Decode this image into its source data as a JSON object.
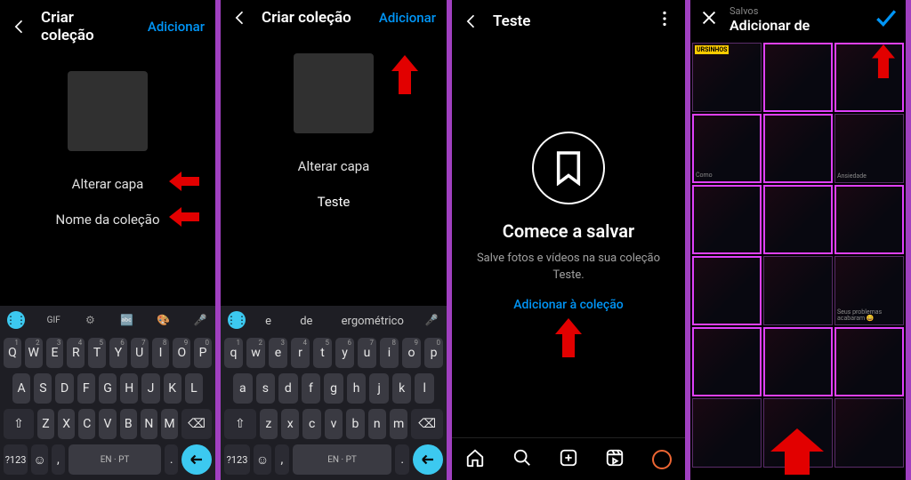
{
  "panel1": {
    "title": "Criar coleção",
    "action": "Adicionar",
    "alterar": "Alterar capa",
    "name_placeholder": "Nome da coleção",
    "kbd_top": {
      "gif": "GIF"
    },
    "rows": [
      [
        "Q",
        "W",
        "E",
        "R",
        "T",
        "Y",
        "U",
        "I",
        "O",
        "P"
      ],
      [
        "A",
        "S",
        "D",
        "F",
        "G",
        "H",
        "J",
        "K",
        "L"
      ],
      [
        "Z",
        "X",
        "C",
        "V",
        "B",
        "N",
        "M"
      ]
    ],
    "numkey": "?123",
    "lang": "EN · PT"
  },
  "panel2": {
    "title": "Criar coleção",
    "action": "Adicionar",
    "alterar": "Alterar capa",
    "name_value": "Teste",
    "suggestions": [
      "e",
      "de",
      "ergométrico"
    ],
    "rows": [
      [
        "q",
        "w",
        "e",
        "r",
        "t",
        "y",
        "u",
        "i",
        "o",
        "p"
      ],
      [
        "a",
        "s",
        "d",
        "f",
        "g",
        "h",
        "j",
        "k",
        "l"
      ],
      [
        "z",
        "x",
        "c",
        "v",
        "b",
        "n",
        "m"
      ]
    ],
    "numkey": "?123",
    "lang": "EN · PT"
  },
  "panel3": {
    "title": "Teste",
    "empty_title": "Comece a salvar",
    "empty_sub": "Salve fotos e vídeos na sua coleção Teste.",
    "empty_link": "Adicionar à coleção"
  },
  "panel4": {
    "sub": "Salvos",
    "title": "Adicionar de",
    "thumbs": [
      {
        "tag": "URSINHOS"
      },
      {
        "sel": true
      },
      {
        "sel": true
      },
      {
        "sel": true,
        "cap": "Como"
      },
      {
        "sel": true
      },
      {
        "cap": "Ansiedade"
      },
      {
        "sel": true
      },
      {
        "sel": true
      },
      {
        "sel": true
      },
      {
        "sel": true
      },
      {},
      {
        "cap": "Seus problemas acabaram 😄"
      },
      {
        "sel": true
      },
      {
        "sel": true
      },
      {
        "sel": true
      },
      {},
      {},
      {}
    ]
  }
}
